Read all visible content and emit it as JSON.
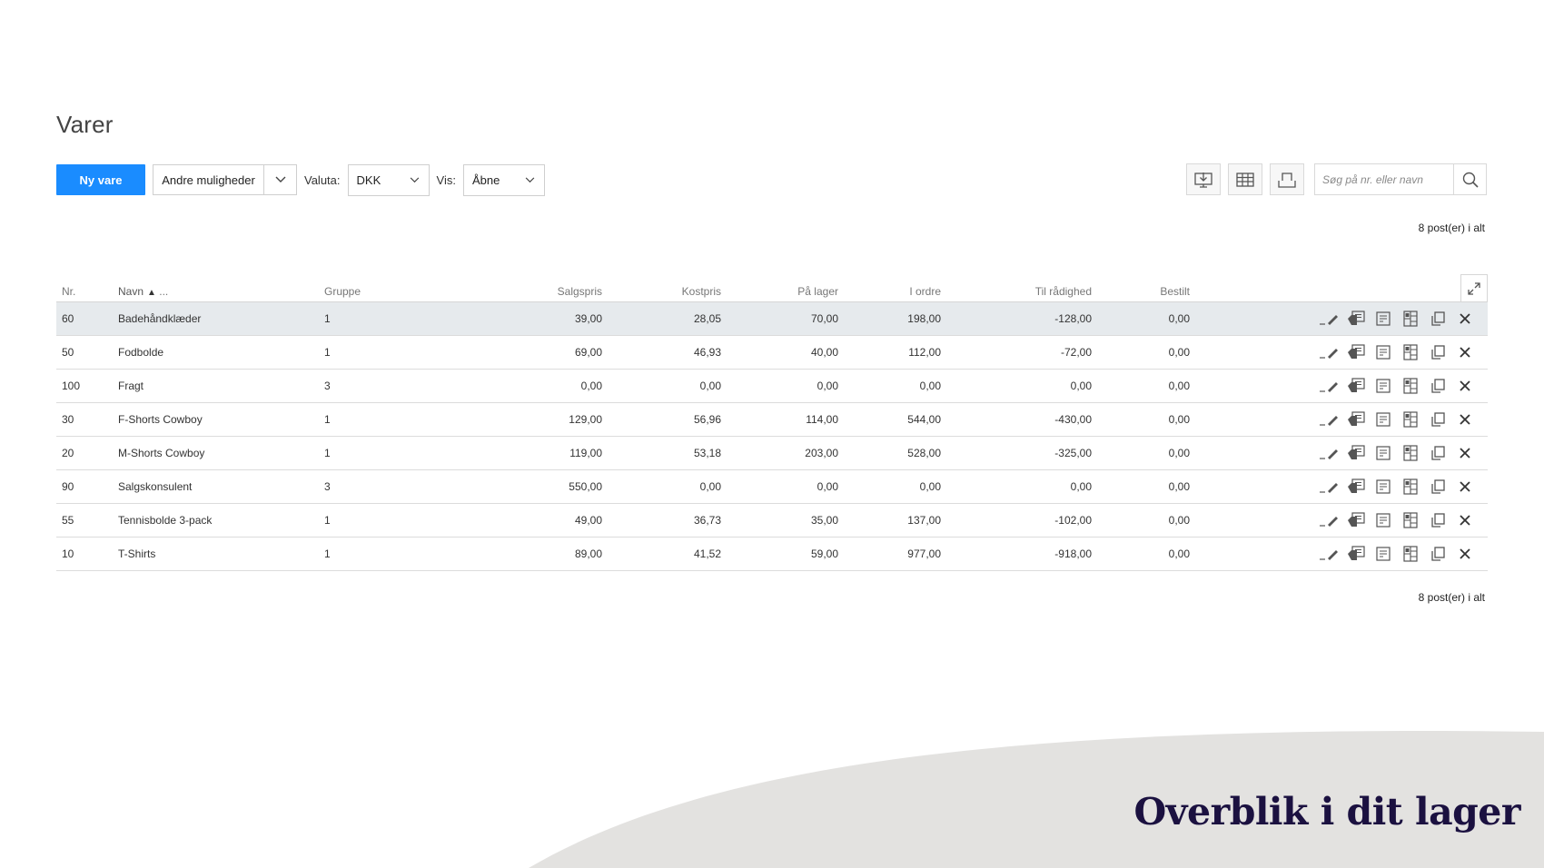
{
  "page": {
    "title": "Varer"
  },
  "toolbar": {
    "new_button": "Ny vare",
    "other_options": "Andre muligheder",
    "currency_label": "Valuta:",
    "currency_value": "DKK",
    "show_label": "Vis:",
    "show_value": "Åbne",
    "search_placeholder": "Søg på nr. eller navn"
  },
  "counts": {
    "top": "8 post(er) i alt",
    "bottom": "8 post(er) i alt"
  },
  "table": {
    "headers": {
      "nr": "Nr.",
      "navn": "Navn",
      "navn_more": "...",
      "gruppe": "Gruppe",
      "salgspris": "Salgspris",
      "kostpris": "Kostpris",
      "paa_lager": "På lager",
      "i_ordre": "I ordre",
      "til_raadighed": "Til rådighed",
      "bestilt": "Bestilt"
    },
    "rows": [
      {
        "nr": "60",
        "navn": "Badehåndklæder",
        "gruppe": "1",
        "salgspris": "39,00",
        "kostpris": "28,05",
        "paa_lager": "70,00",
        "i_ordre": "198,00",
        "til_raadighed": "-128,00",
        "bestilt": "0,00"
      },
      {
        "nr": "50",
        "navn": "Fodbolde",
        "gruppe": "1",
        "salgspris": "69,00",
        "kostpris": "46,93",
        "paa_lager": "40,00",
        "i_ordre": "112,00",
        "til_raadighed": "-72,00",
        "bestilt": "0,00"
      },
      {
        "nr": "100",
        "navn": "Fragt",
        "gruppe": "3",
        "salgspris": "0,00",
        "kostpris": "0,00",
        "paa_lager": "0,00",
        "i_ordre": "0,00",
        "til_raadighed": "0,00",
        "bestilt": "0,00"
      },
      {
        "nr": "30",
        "navn": "F-Shorts Cowboy",
        "gruppe": "1",
        "salgspris": "129,00",
        "kostpris": "56,96",
        "paa_lager": "114,00",
        "i_ordre": "544,00",
        "til_raadighed": "-430,00",
        "bestilt": "0,00"
      },
      {
        "nr": "20",
        "navn": "M-Shorts Cowboy",
        "gruppe": "1",
        "salgspris": "119,00",
        "kostpris": "53,18",
        "paa_lager": "203,00",
        "i_ordre": "528,00",
        "til_raadighed": "-325,00",
        "bestilt": "0,00"
      },
      {
        "nr": "90",
        "navn": "Salgskonsulent",
        "gruppe": "3",
        "salgspris": "550,00",
        "kostpris": "0,00",
        "paa_lager": "0,00",
        "i_ordre": "0,00",
        "til_raadighed": "0,00",
        "bestilt": "0,00"
      },
      {
        "nr": "55",
        "navn": "Tennisbolde 3-pack",
        "gruppe": "1",
        "salgspris": "49,00",
        "kostpris": "36,73",
        "paa_lager": "35,00",
        "i_ordre": "137,00",
        "til_raadighed": "-102,00",
        "bestilt": "0,00"
      },
      {
        "nr": "10",
        "navn": "T-Shirts",
        "gruppe": "1",
        "salgspris": "89,00",
        "kostpris": "41,52",
        "paa_lager": "59,00",
        "i_ordre": "977,00",
        "til_raadighed": "-918,00",
        "bestilt": "0,00"
      }
    ],
    "selected_row": 0,
    "row_actions": [
      "edit-icon",
      "price-list-icon",
      "notes-icon",
      "layout-icon",
      "copy-icon",
      "delete-icon"
    ]
  },
  "footer": {
    "slogan": "Overblik i dit lager"
  },
  "colors": {
    "primary": "#1a8cff",
    "selected_row": "#e6eaed",
    "wave": "#e3e2e0",
    "slogan": "#1b1140"
  }
}
